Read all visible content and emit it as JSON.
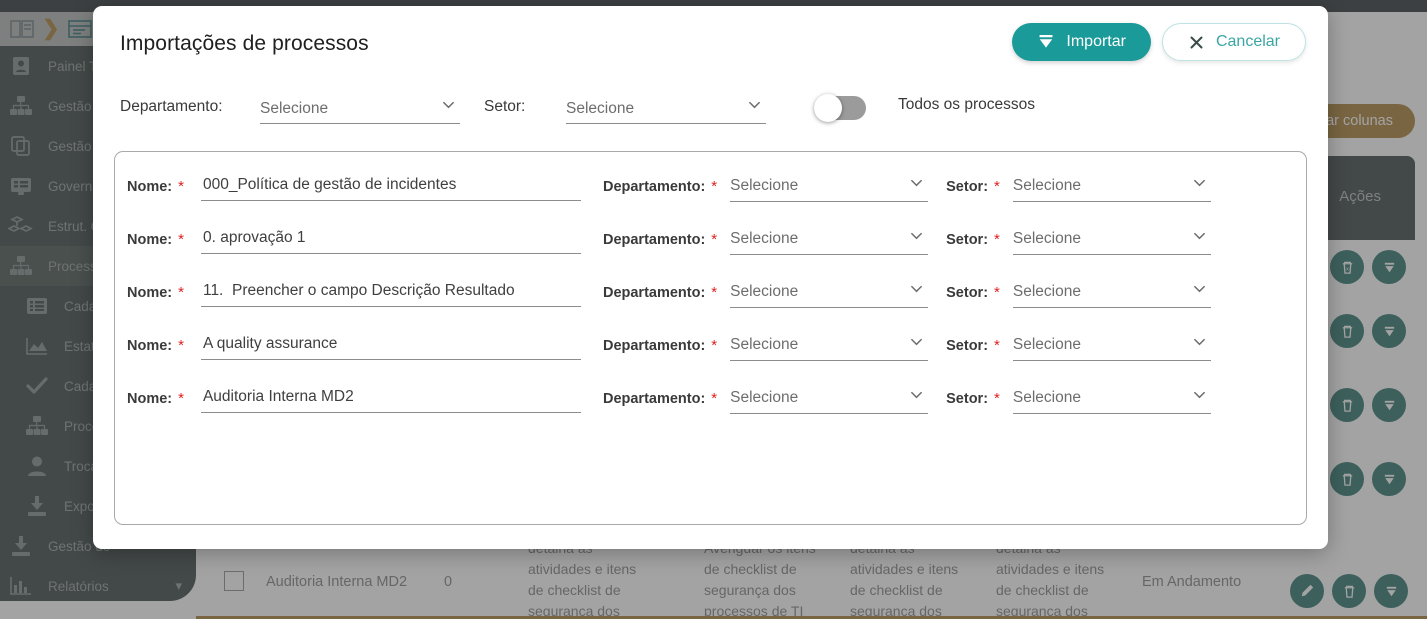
{
  "background": {
    "breadcrumb": {
      "icons": [
        "computer-icon",
        "chevron-right-icon",
        "window-icon"
      ]
    },
    "sidebar": {
      "items": [
        {
          "label": "Painel Tare",
          "icon": "user-badge-icon",
          "active": false,
          "sub": false
        },
        {
          "label": "Gestão de",
          "icon": "org-chart-icon",
          "active": false,
          "sub": false
        },
        {
          "label": "Gestão de",
          "icon": "copy-icon",
          "active": false,
          "sub": false
        },
        {
          "label": "Governanç",
          "icon": "list-window-icon",
          "active": false,
          "sub": false
        },
        {
          "label": "Estrut. Or",
          "icon": "blocks-icon",
          "active": false,
          "sub": false
        },
        {
          "label": "Processo",
          "icon": "org-chart-icon",
          "active": true,
          "sub": false
        },
        {
          "label": "Cadastro",
          "icon": "list-icon",
          "active": false,
          "sub": true
        },
        {
          "label": "Estatísti",
          "icon": "area-chart-icon",
          "active": false,
          "sub": true
        },
        {
          "label": "Cadastro",
          "icon": "check-icon",
          "active": false,
          "sub": true
        },
        {
          "label": "Processo",
          "icon": "org-chart-icon",
          "active": false,
          "sub": true
        },
        {
          "label": "Trocar aut",
          "icon": "person-icon",
          "active": false,
          "sub": true
        },
        {
          "label": "Exportaçã",
          "icon": "download-icon",
          "active": false,
          "sub": true
        },
        {
          "label": "Gestão de",
          "icon": "download-icon",
          "active": false,
          "sub": false
        },
        {
          "label": "Relatórios",
          "icon": "bar-chart-icon",
          "active": false,
          "sub": false,
          "caret": "chevron-down-icon"
        }
      ]
    },
    "columns_button": "ar colunas",
    "table": {
      "actions_header": "Ações",
      "row": {
        "name": "Auditoria Interna MD2",
        "count": "0",
        "col3": "detalha as\natividades e itens\nde checklist de\nsegurança dos",
        "col4": "Averiguar os itens\nde checklist de\nsegurança dos\nprocessos de TI",
        "col5": "detalha as\natividades e itens\nde checklist de\nsegurança dos",
        "col6": "detalha as\natividades e itens\nde checklist de\nsegurança dos",
        "status": "Em Andamento"
      }
    }
  },
  "modal": {
    "title": "Importações de processos",
    "import_label": "Importar",
    "import_icon": "import-eject-icon",
    "cancel_label": "Cancelar",
    "cancel_icon": "close-x-icon",
    "filters": {
      "departamento_label": "Departamento:",
      "departamento_value": "Selecione",
      "setor_label": "Setor:",
      "setor_value": "Selecione",
      "toggle_label": "Todos os processos",
      "toggle_on": false
    },
    "field_labels": {
      "nome": "Nome:",
      "departamento": "Departamento:",
      "setor": "Setor:",
      "required_mark": "*"
    },
    "rows": [
      {
        "nome": "000_Política de gestão de incidentes",
        "departamento": "Selecione",
        "setor": "Selecione"
      },
      {
        "nome": "0. aprovação 1",
        "departamento": "Selecione",
        "setor": "Selecione"
      },
      {
        "nome": "11.  Preencher o campo Descrição Resultado",
        "departamento": "Selecione",
        "setor": "Selecione"
      },
      {
        "nome": "A quality assurance",
        "departamento": "Selecione",
        "setor": "Selecione"
      },
      {
        "nome": "Auditoria Interna MD2",
        "departamento": "Selecione",
        "setor": "Selecione"
      }
    ]
  },
  "colors": {
    "teal": "#1a9a98",
    "teal_light": "#3aa6a4",
    "gold": "#b08b46",
    "sidebar": "#4a5654",
    "required": "#e02020"
  }
}
